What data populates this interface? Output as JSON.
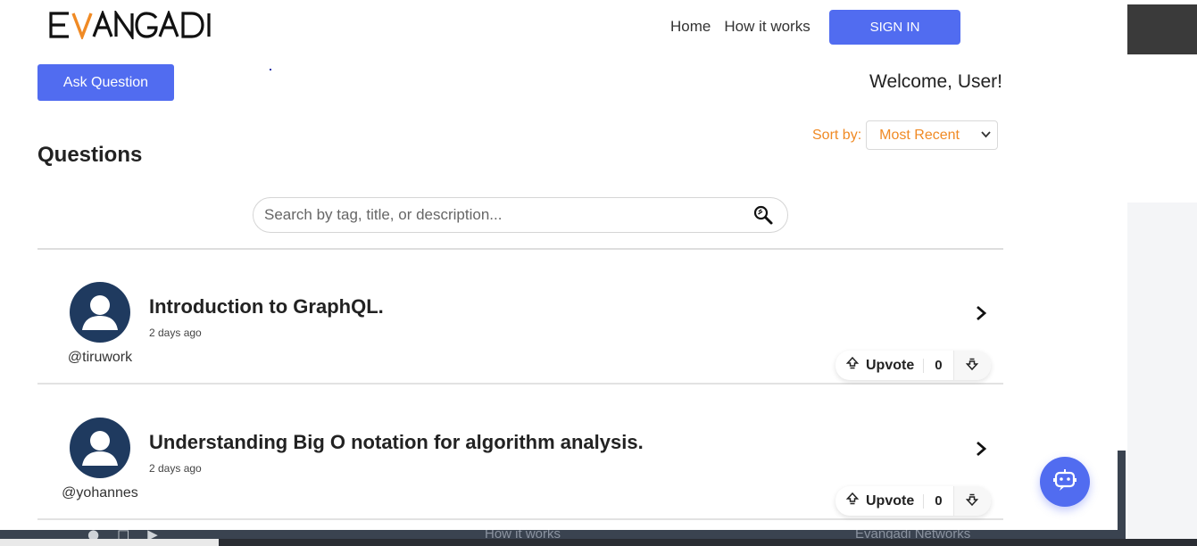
{
  "header": {
    "logo_text": "EVANGADI",
    "nav": [
      "Home",
      "How it works"
    ],
    "signin_label": "SIGN IN"
  },
  "toolbar": {
    "ask_label": "Ask Question",
    "welcome": "Welcome, User!",
    "sort_label": "Sort by:",
    "sort_value": "Most Recent"
  },
  "main": {
    "title": "Questions",
    "search_placeholder": "Search by tag, title, or description...",
    "questions": [
      {
        "title": "Introduction to GraphQL.",
        "time": "2 days ago",
        "user": "@tiruwork",
        "upvote_label": "Upvote",
        "votes": "0"
      },
      {
        "title": "Understanding Big O notation for algorithm analysis.",
        "time": "2 days ago",
        "user": "@yohannes",
        "upvote_label": "Upvote",
        "votes": "0"
      }
    ]
  },
  "footer": {
    "how_it_works": "How it works",
    "networks": "Evangadi Networks"
  },
  "colors": {
    "accent": "#516cf0",
    "orange": "#f08a24",
    "avatar": "#1f3a5f",
    "footer": "#3a4350"
  },
  "icons": [
    "search-icon",
    "chevron-right-icon",
    "upvote-icon",
    "downvote-icon",
    "chatbot-icon",
    "user-avatar-icon",
    "facebook-icon",
    "instagram-icon",
    "youtube-icon"
  ]
}
